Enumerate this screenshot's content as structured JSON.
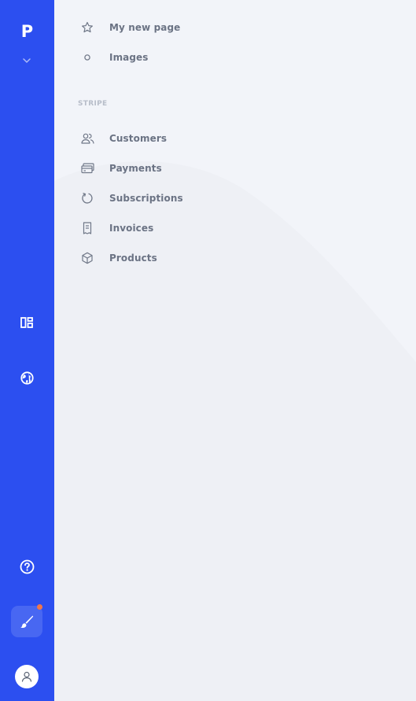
{
  "rail": {
    "logo_letter": "P"
  },
  "nav": {
    "items": [
      {
        "label": "My new page",
        "icon": "star-icon"
      },
      {
        "label": "Images",
        "icon": "circle-icon"
      }
    ],
    "section_label": "STRIPE",
    "stripe_items": [
      {
        "label": "Customers",
        "icon": "users-icon"
      },
      {
        "label": "Payments",
        "icon": "credit-card-icon"
      },
      {
        "label": "Subscriptions",
        "icon": "refresh-icon"
      },
      {
        "label": "Invoices",
        "icon": "receipt-icon"
      },
      {
        "label": "Products",
        "icon": "box-icon"
      }
    ]
  },
  "colors": {
    "rail": "#2c4ff0",
    "background": "#f2f4f9",
    "nav_text": "#6b7384",
    "section_text": "#b7bdc9",
    "notification": "#f0764a"
  }
}
